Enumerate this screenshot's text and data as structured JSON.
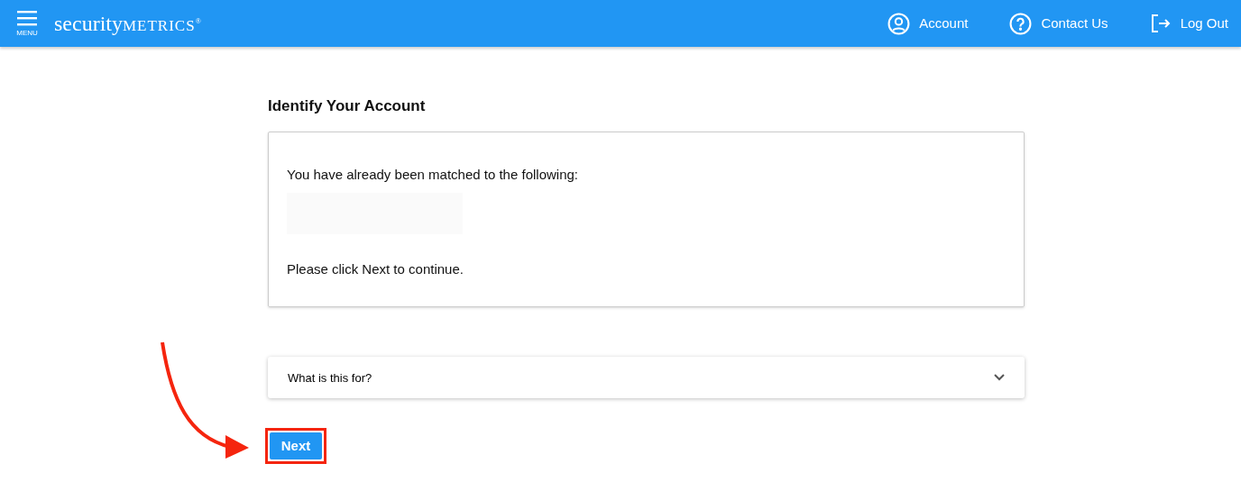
{
  "header": {
    "menu_label": "MENU",
    "logo": {
      "lead": "security",
      "tail": "METRICS",
      "mark": "®"
    },
    "links": [
      {
        "label": "Account",
        "kind": "account"
      },
      {
        "label": "Contact Us",
        "kind": "help"
      },
      {
        "label": "Log Out",
        "kind": "logout"
      }
    ]
  },
  "title": "Identify Your Account",
  "card": {
    "intro": "You have already been matched to the following:",
    "outro": "Please click Next to continue."
  },
  "accordion": {
    "label": "What is this for?",
    "expanded": false
  },
  "next_button": "Next"
}
